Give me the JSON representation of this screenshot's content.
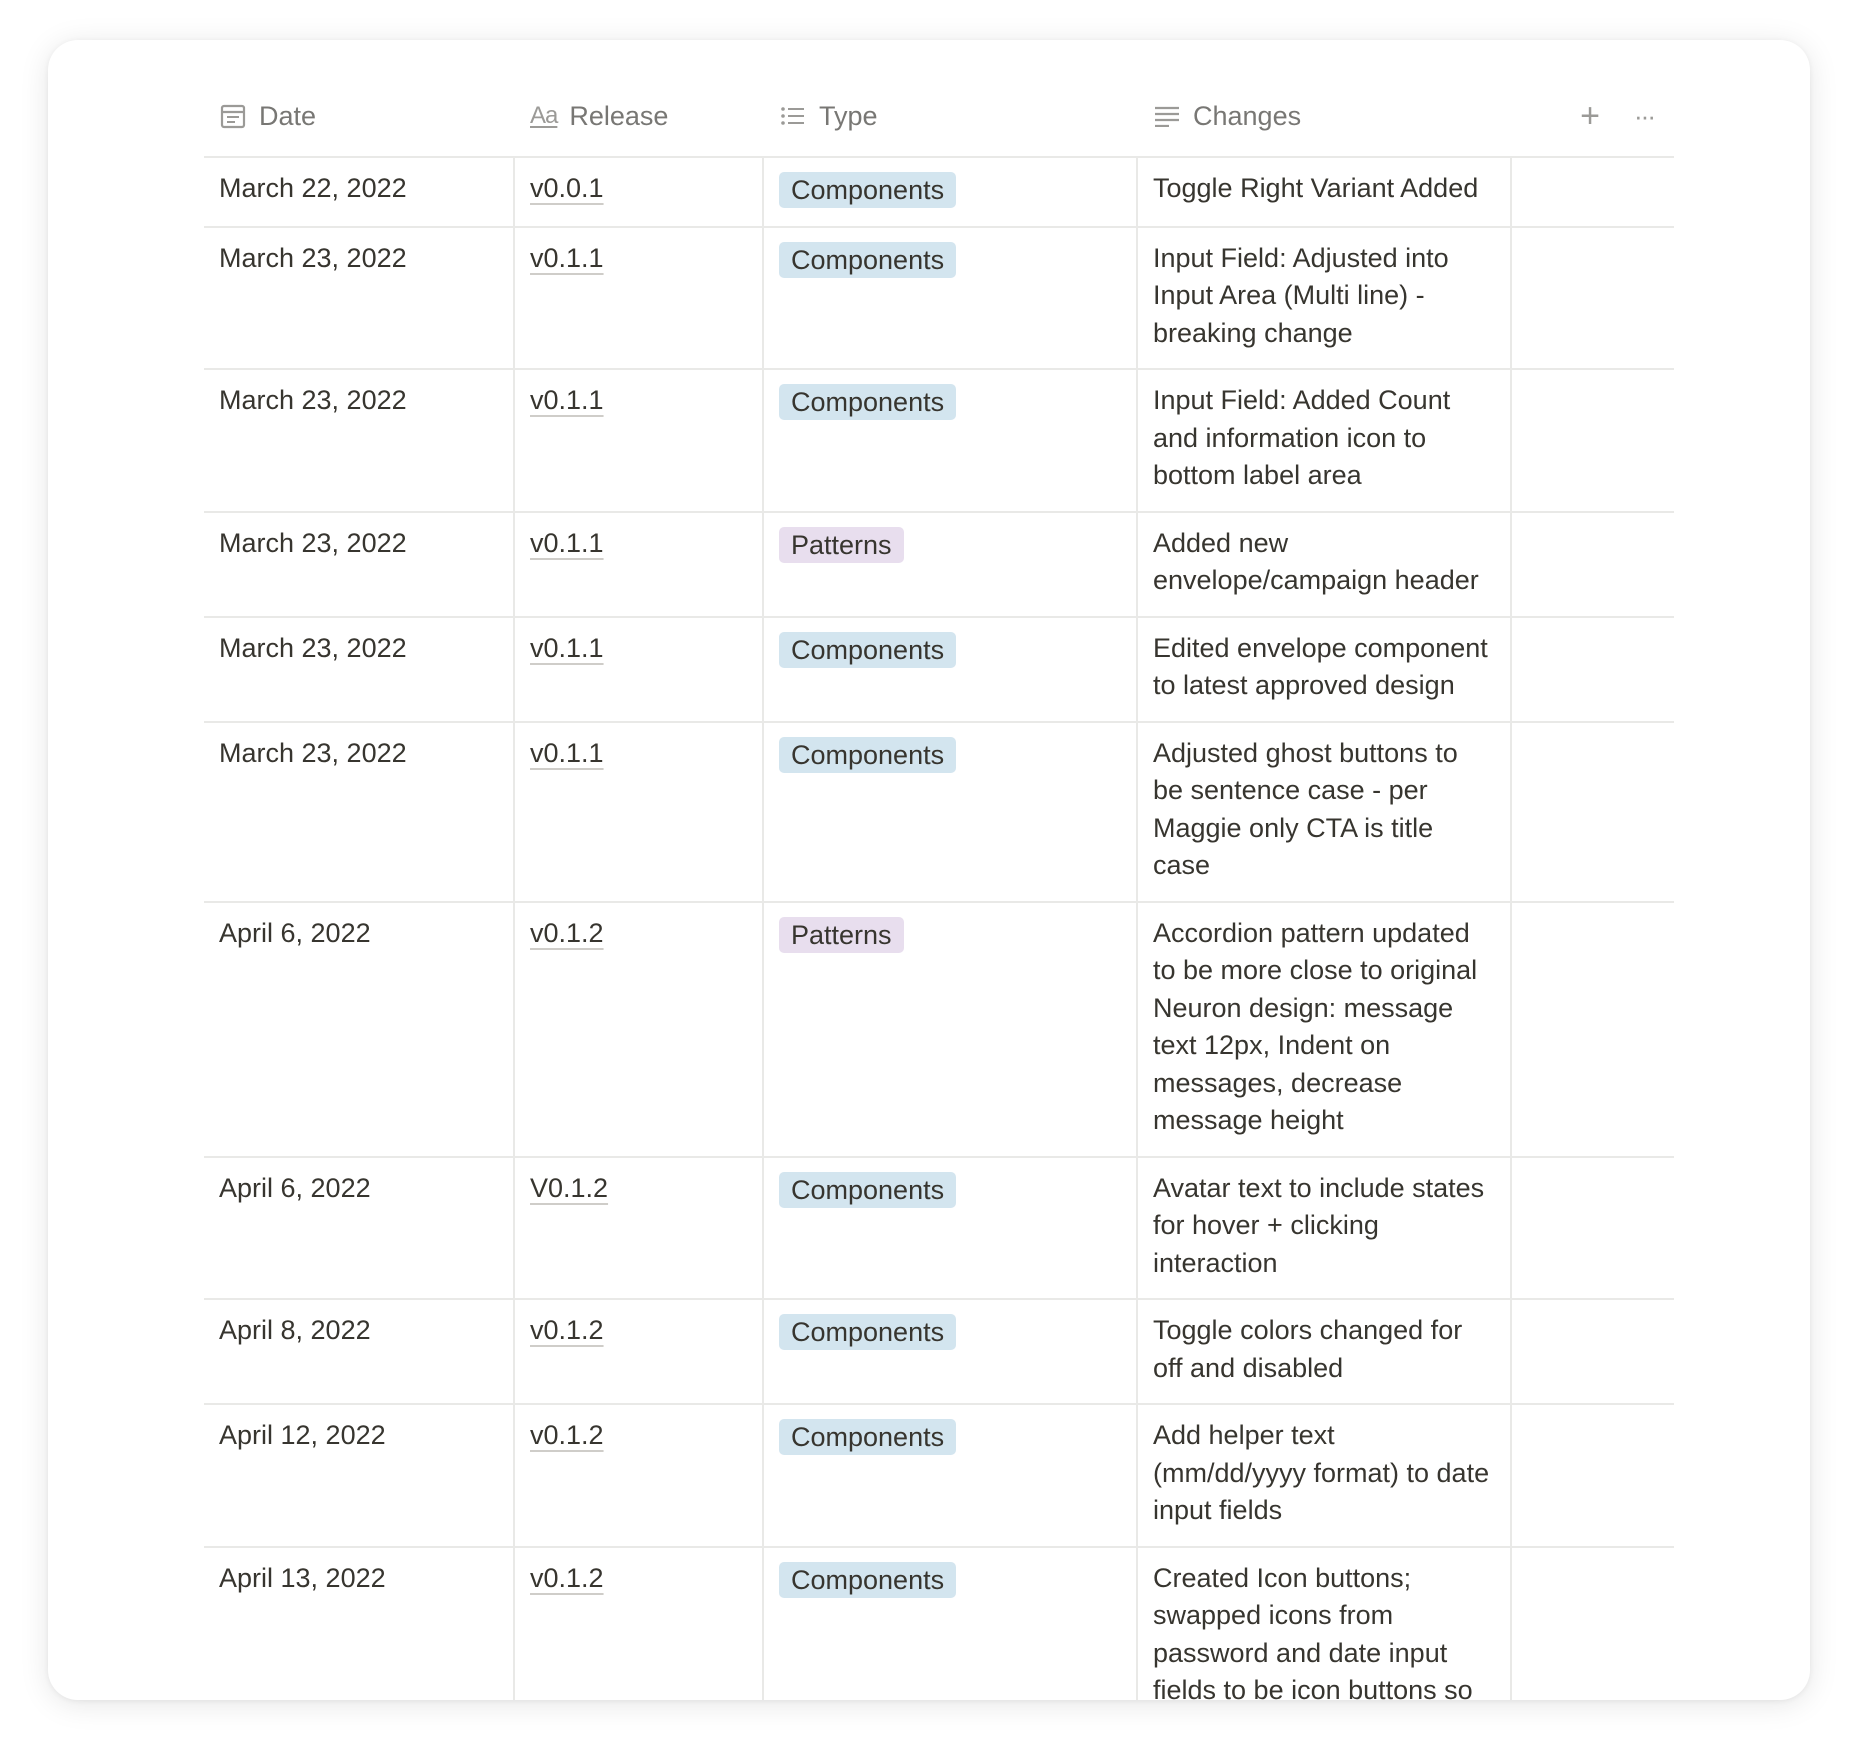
{
  "columns": {
    "date": "Date",
    "release": "Release",
    "type": "Type",
    "changes": "Changes",
    "release_icon_text": "Aa"
  },
  "header_actions": {
    "add_icon": "+",
    "more_icon": "···"
  },
  "tag_colors": {
    "Components": "#d3e5ef",
    "Patterns": "#e8deee"
  },
  "rows": [
    {
      "date": "March 22, 2022",
      "release": "v0.0.1",
      "type": "Components",
      "changes": "Toggle Right Variant Added"
    },
    {
      "date": "March 23, 2022",
      "release": "v0.1.1",
      "type": "Components",
      "changes": "Input Field: Adjusted into Input Area (Multi line) - breaking change"
    },
    {
      "date": "March 23, 2022",
      "release": "v0.1.1",
      "type": "Components",
      "changes": "Input Field: Added Count and information icon to bottom label area"
    },
    {
      "date": "March 23, 2022",
      "release": "v0.1.1",
      "type": "Patterns",
      "changes": "Added new envelope/campaign header"
    },
    {
      "date": "March 23, 2022",
      "release": "v0.1.1",
      "type": "Components",
      "changes": "Edited envelope component to latest approved design"
    },
    {
      "date": "March 23, 2022",
      "release": "v0.1.1",
      "type": "Components",
      "changes": "Adjusted ghost buttons to be sentence case - per Maggie only CTA is title case"
    },
    {
      "date": "April 6, 2022",
      "release": "v0.1.2",
      "type": "Patterns",
      "changes": "Accordion pattern updated to be more close to original Neuron design: message text 12px, Indent on messages, decrease message height"
    },
    {
      "date": "April 6, 2022",
      "release": "V0.1.2",
      "type": "Components",
      "changes": "Avatar text to include states for hover + clicking interaction"
    },
    {
      "date": "April 8, 2022",
      "release": "v0.1.2",
      "type": "Components",
      "changes": "Toggle colors changed for off and disabled"
    },
    {
      "date": "April 12, 2022",
      "release": "v0.1.2",
      "type": "Components",
      "changes": "Add helper text (mm/dd/yyyy format) to date input fields"
    },
    {
      "date": "April 13, 2022",
      "release": "v0.1.2",
      "type": "Components",
      "changes": "Created Icon buttons; swapped icons from password and date input fields to be icon buttons so that the interactions can be accounted for"
    }
  ]
}
